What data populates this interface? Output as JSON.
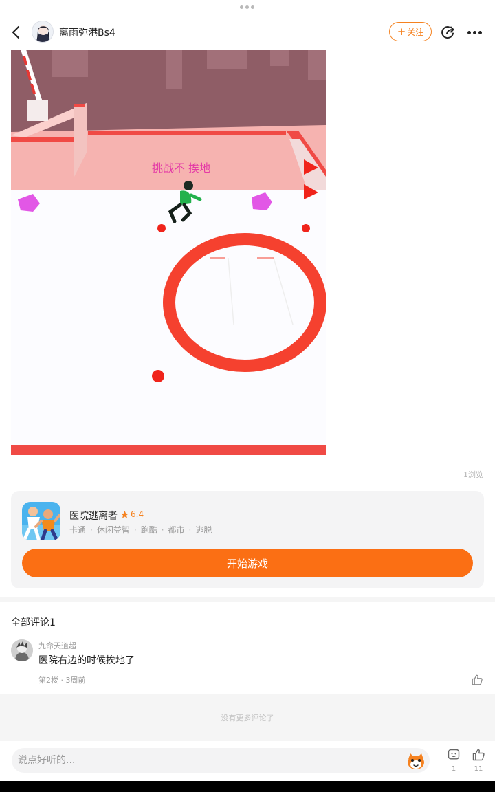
{
  "header": {
    "username": "离雨弥港Bs4",
    "follow_label": "关注"
  },
  "post": {
    "image_caption": "挑战不 挨地",
    "views": "1浏览"
  },
  "game": {
    "name": "医院逃离者",
    "rating": "6.4",
    "tags": [
      "卡通",
      "休闲益智",
      "跑酷",
      "都市",
      "逃脱"
    ],
    "play_label": "开始游戏"
  },
  "comments": {
    "title": "全部评论1",
    "items": [
      {
        "user": "九命天道超",
        "text": "医院右边的时候挨地了",
        "meta": "第2楼 · 3周前"
      }
    ],
    "no_more": "没有更多评论了"
  },
  "bottom_bar": {
    "input_placeholder": "说点好听的...",
    "emoji_count": "1",
    "like_count": "11"
  },
  "colors": {
    "accent": "#fb6f14",
    "follow": "#f58220",
    "caption": "#e43ba6",
    "ring": "#f5412f"
  }
}
